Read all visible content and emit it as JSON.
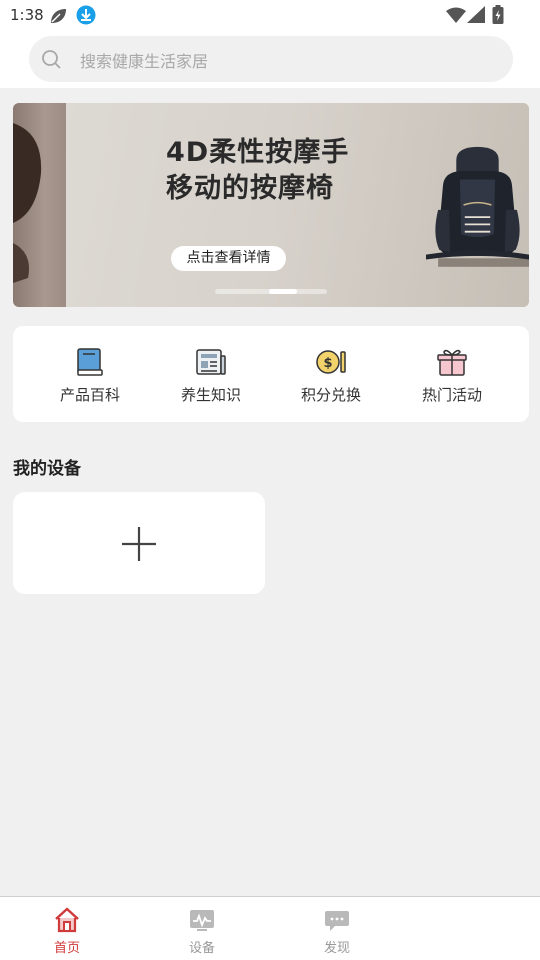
{
  "status_bar": {
    "time": "1:38"
  },
  "search": {
    "placeholder": "搜索健康生活家居"
  },
  "banner": {
    "title_line1": "4D柔性按摩手",
    "title_line2": "移动的按摩椅",
    "button_label": "点击查看详情",
    "slide_count": 4,
    "active_slide": 3
  },
  "quick_links": [
    {
      "label": "产品百科",
      "icon": "book-icon"
    },
    {
      "label": "养生知识",
      "icon": "newspaper-icon"
    },
    {
      "label": "积分兑换",
      "icon": "coin-exchange-icon"
    },
    {
      "label": "热门活动",
      "icon": "gift-icon"
    }
  ],
  "devices": {
    "title": "我的设备"
  },
  "bottom_nav": [
    {
      "label": "首页",
      "icon": "home-icon",
      "active": true
    },
    {
      "label": "设备",
      "icon": "device-monitor-icon",
      "active": false
    },
    {
      "label": "发现",
      "icon": "chat-bubble-icon",
      "active": false
    }
  ],
  "colors": {
    "accent": "#d03a3a",
    "page_background": "#f0f0f0",
    "card_background": "#ffffff",
    "inactive_nav": "#999999"
  }
}
